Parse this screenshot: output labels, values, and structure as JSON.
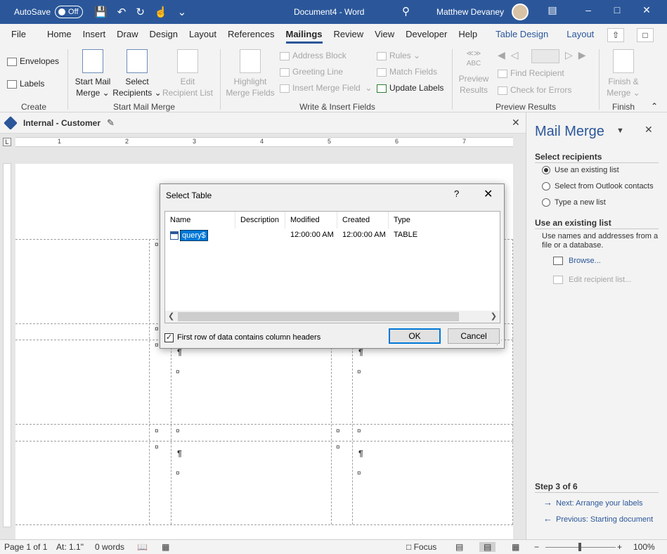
{
  "titlebar": {
    "autosave_label": "AutoSave",
    "autosave_state": "Off",
    "document_title": "Document4 - Word",
    "user_name": "Matthew Devaney"
  },
  "ribbon_tabs": [
    "File",
    "Home",
    "Insert",
    "Draw",
    "Design",
    "Layout",
    "References",
    "Mailings",
    "Review",
    "View",
    "Developer",
    "Help",
    "Table Design",
    "Layout"
  ],
  "active_tab": "Mailings",
  "ribbon": {
    "create": {
      "envelopes": "Envelopes",
      "labels": "Labels",
      "group": "Create"
    },
    "start_mail_merge": {
      "start_line1": "Start Mail",
      "start_line2": "Merge",
      "select_line1": "Select",
      "select_line2": "Recipients",
      "edit_line1": "Edit",
      "edit_line2": "Recipient List",
      "group": "Start Mail Merge"
    },
    "write_insert": {
      "highlight_line1": "Highlight",
      "highlight_line2": "Merge Fields",
      "address_block": "Address Block",
      "greeting_line": "Greeting Line",
      "insert_merge_field": "Insert Merge Field",
      "rules": "Rules",
      "match_fields": "Match Fields",
      "update_labels": "Update Labels",
      "group": "Write & Insert Fields"
    },
    "preview": {
      "abc": "ABC",
      "preview_line1": "Preview",
      "preview_line2": "Results",
      "find_recipient": "Find Recipient",
      "check_errors": "Check for Errors",
      "group": "Preview Results"
    },
    "finish": {
      "finish_line1": "Finish &",
      "finish_line2": "Merge",
      "group": "Finish"
    }
  },
  "doc_tab": {
    "name": "Internal - Customer"
  },
  "ruler_numbers": [
    "1",
    "2",
    "3",
    "4",
    "5",
    "6",
    "7"
  ],
  "dialog": {
    "title": "Select Table",
    "help": "?",
    "columns": [
      "Name",
      "Description",
      "Modified",
      "Created",
      "Type"
    ],
    "rows": [
      {
        "name": "query$",
        "description": "",
        "modified": "12:00:00 AM",
        "created": "12:00:00 AM",
        "type": "TABLE"
      }
    ],
    "checkbox_label": "First row of data contains column headers",
    "checkbox_checked": true,
    "ok_label": "OK",
    "cancel_label": "Cancel"
  },
  "mail_merge_pane": {
    "title": "Mail Merge",
    "select_recipients_heading": "Select recipients",
    "options": [
      "Use an existing list",
      "Select from Outlook contacts",
      "Type a new list"
    ],
    "selected_option": 0,
    "existing_list_heading": "Use an existing list",
    "existing_list_desc": "Use names and addresses from a file or a database.",
    "browse": "Browse...",
    "edit_recipient_list": "Edit recipient list...",
    "step": "Step 3 of 6",
    "next": "Next: Arrange your labels",
    "previous": "Previous: Starting document"
  },
  "status": {
    "page": "Page 1 of 1",
    "at": "At: 1.1\"",
    "words": "0 words",
    "focus": "Focus",
    "zoom": "100%"
  },
  "doc_marks": {
    "cell_end": "¤",
    "paragraph": "¶"
  }
}
